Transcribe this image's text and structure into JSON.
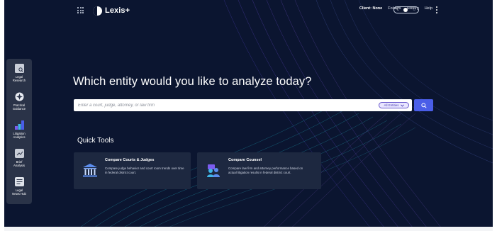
{
  "app": {
    "brand": "Lexis+"
  },
  "topnav": {
    "client_label": "Client: None",
    "folders": "Folders",
    "history": "History",
    "help": "Help"
  },
  "sidebar": {
    "items": [
      {
        "label": "Legal\nResearch",
        "icon": "legal-research-icon"
      },
      {
        "label": "Practical\nGuidance",
        "icon": "practical-guidance-icon"
      },
      {
        "label": "Litigation\nAnalytics",
        "icon": "litigation-analytics-icon"
      },
      {
        "label": "Brief\nAnalysis",
        "icon": "brief-analysis-icon"
      },
      {
        "label": "Legal\nNews Hub",
        "icon": "legal-news-hub-icon"
      }
    ]
  },
  "main": {
    "headline": "Which entity would you like to analyze today?",
    "search": {
      "placeholder": "Enter a court, judge, attorney, or law firm",
      "value": "",
      "entity_filter": "All Entities"
    },
    "quick_tools": {
      "title": "Quick Tools",
      "cards": [
        {
          "title": "Compare Courts & Judges",
          "description": "Compare judge behavior and court room trends over time in federal district court.",
          "icon": "courthouse-icon"
        },
        {
          "title": "Compare Counsel",
          "description": "Compare law firm and attorney performance based on actual litigation results in federal district court.",
          "icon": "counsel-icon"
        }
      ]
    }
  },
  "colors": {
    "background": "#0b1530",
    "accent_blue": "#4a5ee8",
    "entity_select_border": "#6a5acd",
    "sidebar_bg": "#2a3348",
    "card_bg": "#1d2840"
  }
}
